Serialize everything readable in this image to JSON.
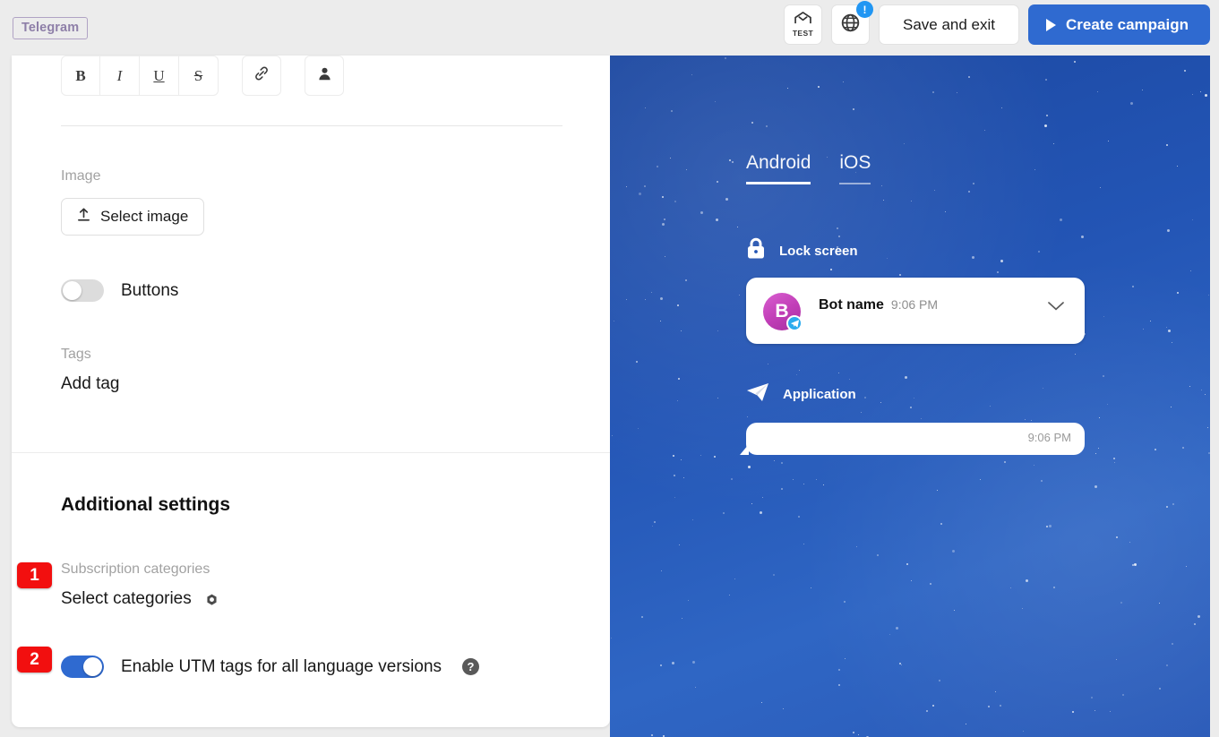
{
  "header": {
    "brand_chip": "Telegram",
    "test_icon_label": "TEST",
    "test_icon_name": "home-envelope-icon",
    "globe_icon_name": "globe-icon",
    "globe_badge": "!",
    "save_label": "Save and exit",
    "create_label": "Create campaign",
    "primary_color": "#2f6ad0",
    "badge_color": "#2196f3"
  },
  "editor": {
    "toolbar": {
      "bold": "B",
      "italic": "I",
      "underline": "U",
      "strike": "S",
      "link_icon": "link-icon",
      "mention_icon": "person-icon"
    },
    "image": {
      "label": "Image",
      "select_button": "Select image",
      "upload_icon": "upload-icon"
    },
    "buttons_toggle": {
      "label": "Buttons",
      "state": "off"
    },
    "tags": {
      "label": "Tags",
      "add_tag": "Add tag"
    },
    "additional": {
      "title": "Additional settings",
      "subscription": {
        "label": "Subscription categories",
        "value": "Select categories",
        "gear_icon": "gear-icon"
      },
      "utm": {
        "label": "Enable UTM tags for all language versions",
        "state": "on",
        "help_icon": "help-circle-icon",
        "help_glyph": "?"
      }
    }
  },
  "annotations": [
    {
      "number": "1",
      "target": "subscription-categories",
      "color": "#f20f0f"
    },
    {
      "number": "2",
      "target": "utm-toggle",
      "color": "#f20f0f"
    }
  ],
  "preview": {
    "tabs": [
      {
        "label": "Android",
        "active": true
      },
      {
        "label": "iOS",
        "active": false
      }
    ],
    "lock_screen": {
      "icon": "lock-icon",
      "title": "Lock screen",
      "notification": {
        "avatar_letter": "B",
        "avatar_badge_icon": "telegram-icon",
        "name": "Bot name",
        "time": "9:06 PM",
        "expand_icon": "chevron-down-icon"
      }
    },
    "application": {
      "icon": "telegram-plane-icon",
      "title": "Application",
      "message": {
        "text": "",
        "time": "9:06 PM"
      }
    },
    "background_color": "#2355b5"
  }
}
